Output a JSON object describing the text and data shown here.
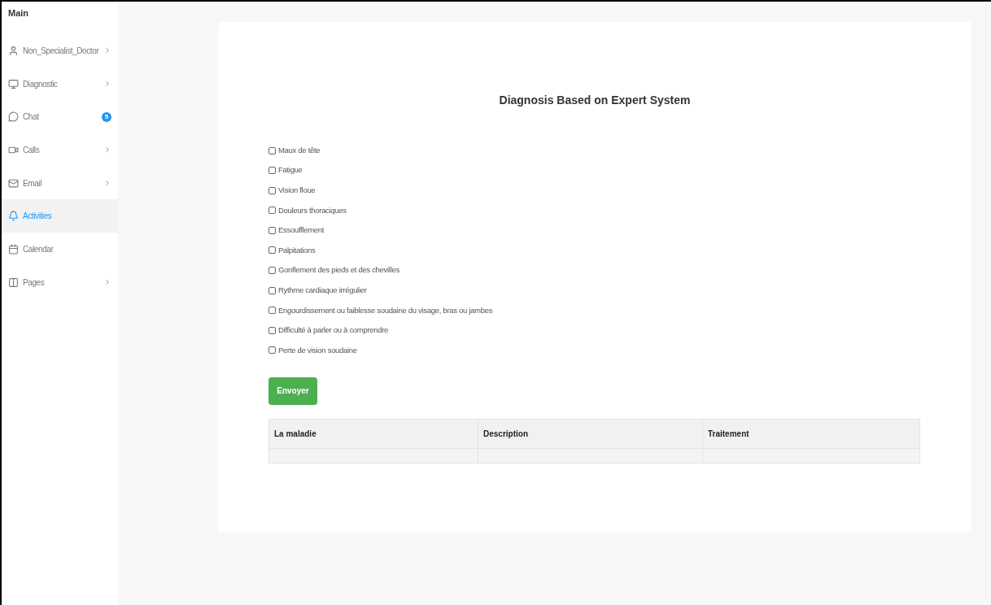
{
  "sidebar": {
    "heading": "Main",
    "items": [
      {
        "label": "Non_Specialist_Doctor",
        "selected": false,
        "submenu": true
      },
      {
        "label": "Diagnostic",
        "selected": false,
        "submenu": true
      },
      {
        "label": "Chat",
        "selected": false,
        "submenu": false,
        "badge": "5"
      },
      {
        "label": "Calls",
        "selected": false,
        "submenu": true
      },
      {
        "label": "Email",
        "selected": false,
        "submenu": true
      },
      {
        "label": "Activities",
        "selected": true,
        "submenu": false
      },
      {
        "label": "Calendar",
        "selected": false,
        "submenu": false
      },
      {
        "label": "Pages",
        "selected": false,
        "submenu": true
      }
    ]
  },
  "form": {
    "title": "Diagnosis Based on Expert System",
    "symptoms": [
      {
        "label": "Maux de tête",
        "checked": false
      },
      {
        "label": "Fatigue",
        "checked": false
      },
      {
        "label": "Vision floue",
        "checked": false
      },
      {
        "label": "Douleurs thoraciques",
        "checked": false
      },
      {
        "label": "Essoufflement",
        "checked": false
      },
      {
        "label": "Palpitations",
        "checked": false
      },
      {
        "label": "Gonflement des pieds et des chevilles",
        "checked": false
      },
      {
        "label": "Rythme cardiaque irrégulier",
        "checked": false
      },
      {
        "label": "Engourdissement ou faiblesse soudaine du visage, bras ou jambes",
        "checked": false
      },
      {
        "label": "Difficulté à parler ou à comprendre",
        "checked": false
      },
      {
        "label": "Perte de vision soudaine",
        "checked": false
      }
    ],
    "submit": "Envoyer"
  },
  "table": {
    "columns": [
      "La maladie",
      "Description",
      "Traitement"
    ]
  }
}
